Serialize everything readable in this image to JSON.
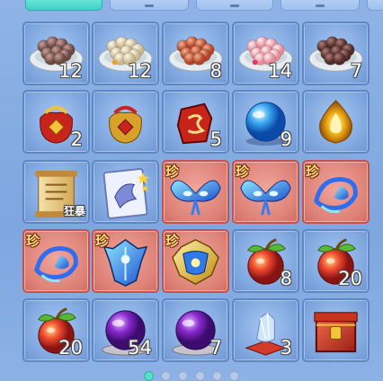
{
  "tabs": [
    {
      "id": "tab-1",
      "active": true
    },
    {
      "id": "tab-2",
      "active": false
    },
    {
      "id": "tab-3",
      "active": false
    },
    {
      "id": "tab-4",
      "active": false
    }
  ],
  "colors": {
    "accent": "#3fd2c6",
    "normal_slot": "#7fa6de",
    "rare_slot": "#de8277",
    "rare_badge": "#f7e07a"
  },
  "slots": [
    {
      "icon": "dumpling-plate-brown-icon",
      "count": "12",
      "rare": false
    },
    {
      "icon": "dumpling-plate-white-icon",
      "count": "12",
      "rare": false
    },
    {
      "icon": "dumpling-plate-red-icon",
      "count": "8",
      "rare": false
    },
    {
      "icon": "dumpling-plate-pink-icon",
      "count": "14",
      "rare": false
    },
    {
      "icon": "dumpling-plate-dark-icon",
      "count": "7",
      "rare": false
    },
    {
      "icon": "red-lucky-bag-icon",
      "count": "2",
      "rare": false
    },
    {
      "icon": "gold-lucky-bag-icon",
      "count": "",
      "rare": false
    },
    {
      "icon": "red-rune-stone-icon",
      "count": "5",
      "rare": false
    },
    {
      "icon": "blue-orb-icon",
      "count": "9",
      "rare": false
    },
    {
      "icon": "golden-flame-icon",
      "count": "",
      "rare": false
    },
    {
      "icon": "scroll-icon",
      "count": "",
      "tag": "狂暴",
      "rare": false
    },
    {
      "icon": "dragon-card-icon",
      "count": "",
      "rare": false
    },
    {
      "icon": "blue-wing-mask-icon",
      "count": "",
      "rare": true,
      "badge": "珍"
    },
    {
      "icon": "blue-wing-mask-icon",
      "count": "",
      "rare": true,
      "badge": "珍"
    },
    {
      "icon": "blue-spirit-bird-icon",
      "count": "",
      "rare": true,
      "badge": "珍"
    },
    {
      "icon": "blue-spirit-bird-icon",
      "count": "",
      "rare": true,
      "badge": "珍"
    },
    {
      "icon": "ice-armor-icon",
      "count": "",
      "rare": true,
      "badge": "珍"
    },
    {
      "icon": "gold-armor-icon",
      "count": "",
      "rare": true,
      "badge": "珍"
    },
    {
      "icon": "red-peach-icon",
      "count": "8",
      "rare": false
    },
    {
      "icon": "red-peach-icon",
      "count": "20",
      "rare": false
    },
    {
      "icon": "red-peach-icon",
      "count": "20",
      "rare": false
    },
    {
      "icon": "purple-orb-icon",
      "count": "54",
      "rare": false
    },
    {
      "icon": "purple-orb-icon",
      "count": "7",
      "rare": false
    },
    {
      "icon": "crystal-pedestal-icon",
      "count": "3",
      "rare": false
    },
    {
      "icon": "red-chest-icon",
      "count": "",
      "rare": false
    }
  ],
  "pagination": {
    "pages": 6,
    "current": 1
  }
}
